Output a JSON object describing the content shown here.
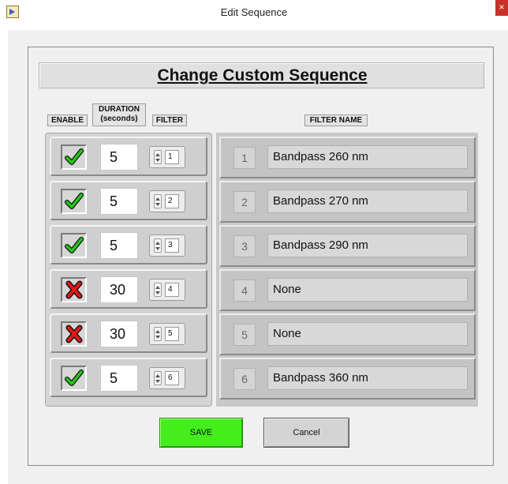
{
  "window": {
    "title": "Edit Sequence",
    "close_glyph": "×"
  },
  "header": {
    "title": "Change Custom Sequence"
  },
  "columns": {
    "enable": "ENABLE",
    "duration_line1": "DURATION",
    "duration_line2": "(seconds)",
    "filter": "FILTER",
    "filter_name": "FILTER NAME"
  },
  "rows": [
    {
      "enabled": true,
      "enable_icon": "green-check-icon",
      "duration": "5",
      "filter": "1"
    },
    {
      "enabled": true,
      "enable_icon": "green-check-icon",
      "duration": "5",
      "filter": "2"
    },
    {
      "enabled": true,
      "enable_icon": "green-check-icon",
      "duration": "5",
      "filter": "3"
    },
    {
      "enabled": false,
      "enable_icon": "red-x-icon",
      "duration": "30",
      "filter": "4"
    },
    {
      "enabled": false,
      "enable_icon": "red-x-icon",
      "duration": "30",
      "filter": "5"
    },
    {
      "enabled": true,
      "enable_icon": "green-check-icon",
      "duration": "5",
      "filter": "6"
    }
  ],
  "filter_names": [
    {
      "index": "1",
      "name": "Bandpass 260 nm"
    },
    {
      "index": "2",
      "name": "Bandpass 270 nm"
    },
    {
      "index": "3",
      "name": "Bandpass 290 nm"
    },
    {
      "index": "4",
      "name": "None"
    },
    {
      "index": "5",
      "name": "None"
    },
    {
      "index": "6",
      "name": "Bandpass 360 nm"
    }
  ],
  "buttons": {
    "save": "SAVE",
    "cancel": "Cancel"
  },
  "colors": {
    "save_green": "#44ee1c",
    "check_green": "#22c818",
    "x_red": "#e01818",
    "close_red": "#c7312a"
  }
}
